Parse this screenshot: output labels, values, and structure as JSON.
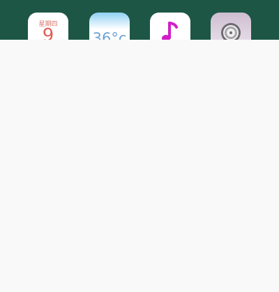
{
  "home_screen": {
    "apps": [
      {
        "name": "calendar",
        "weekday": "星期四",
        "day": "9"
      },
      {
        "name": "weather",
        "temperature": "36°c"
      },
      {
        "name": "music",
        "icon": "music-note-icon"
      },
      {
        "name": "settings",
        "icon": "gear-icon"
      }
    ]
  },
  "colors": {
    "wallpaper": "#1d5645",
    "sheet_background": "#f9f9f9",
    "calendar_red": "#e05f55",
    "weather_blue": "#6ea2d3",
    "music_magenta": "#d21ec8"
  }
}
